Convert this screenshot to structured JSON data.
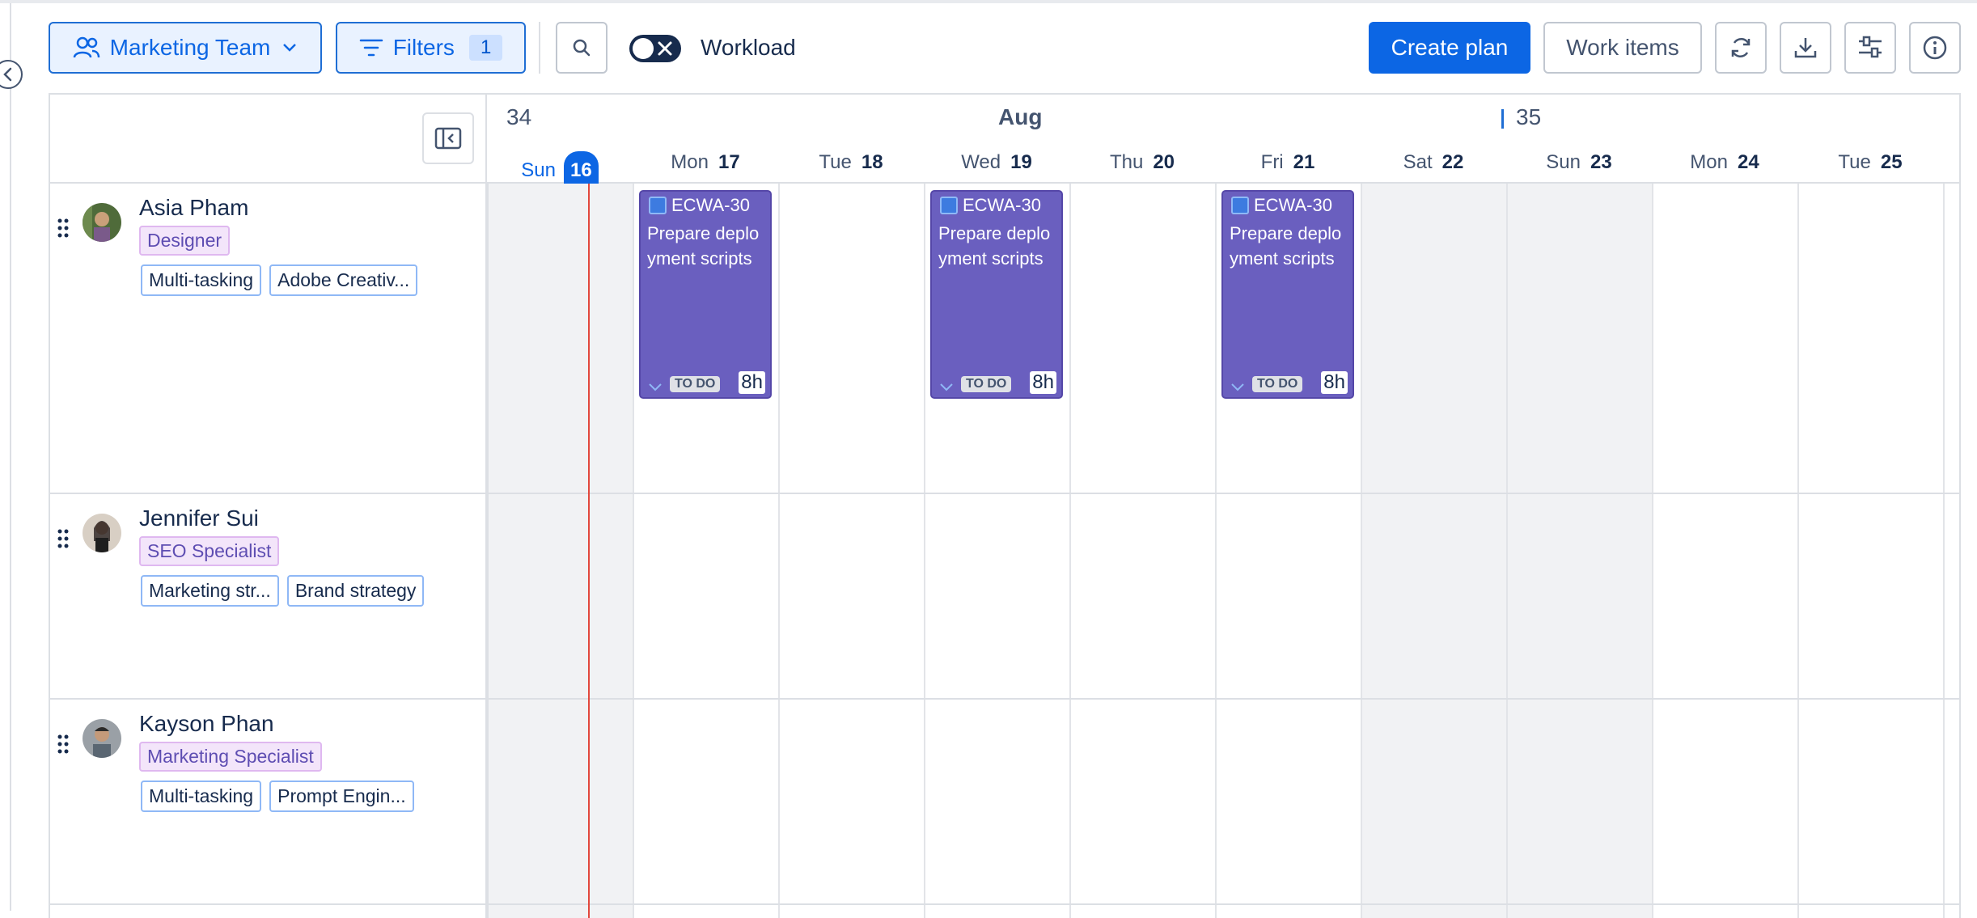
{
  "toolbar": {
    "team_label": "Marketing Team",
    "filters_label": "Filters",
    "filters_count": "1",
    "workload_label": "Workload",
    "workload_toggle": "off",
    "create_plan_label": "Create plan",
    "work_items_label": "Work items"
  },
  "calendar": {
    "month": "Aug",
    "week_start": "34",
    "week_next": "35",
    "days": [
      {
        "name": "Sun",
        "num": "16",
        "today": true
      },
      {
        "name": "Mon",
        "num": "17"
      },
      {
        "name": "Tue",
        "num": "18"
      },
      {
        "name": "Wed",
        "num": "19"
      },
      {
        "name": "Thu",
        "num": "20"
      },
      {
        "name": "Fri",
        "num": "21"
      },
      {
        "name": "Sat",
        "num": "22"
      },
      {
        "name": "Sun",
        "num": "23"
      },
      {
        "name": "Mon",
        "num": "24"
      },
      {
        "name": "Tue",
        "num": "25"
      }
    ]
  },
  "people": [
    {
      "name": "Asia Pham",
      "role": "Designer",
      "skills": [
        "Multi-tasking",
        "Adobe Creativ..."
      ],
      "tasks": [
        {
          "id": "ECWA-30",
          "title": "Prepare deployment scripts",
          "status": "TO DO",
          "hours": "8h",
          "day": "Mon 17"
        },
        {
          "id": "ECWA-30",
          "title": "Prepare deployment scripts",
          "status": "TO DO",
          "hours": "8h",
          "day": "Wed 19"
        },
        {
          "id": "ECWA-30",
          "title": "Prepare deployment scripts",
          "status": "TO DO",
          "hours": "8h",
          "day": "Fri 21"
        }
      ]
    },
    {
      "name": "Jennifer Sui",
      "role": "SEO Specialist",
      "skills": [
        "Marketing str...",
        "Brand strategy"
      ],
      "tasks": []
    },
    {
      "name": "Kayson Phan",
      "role": "Marketing Specialist",
      "skills": [
        "Multi-tasking",
        "Prompt Engin..."
      ],
      "tasks": []
    }
  ],
  "colors": {
    "accent": "#0c66e4",
    "task_bg": "#6a5fbf",
    "role_bg": "#f3e5fa",
    "today_line": "#e2483d",
    "weekend_bg": "#f1f2f4"
  }
}
